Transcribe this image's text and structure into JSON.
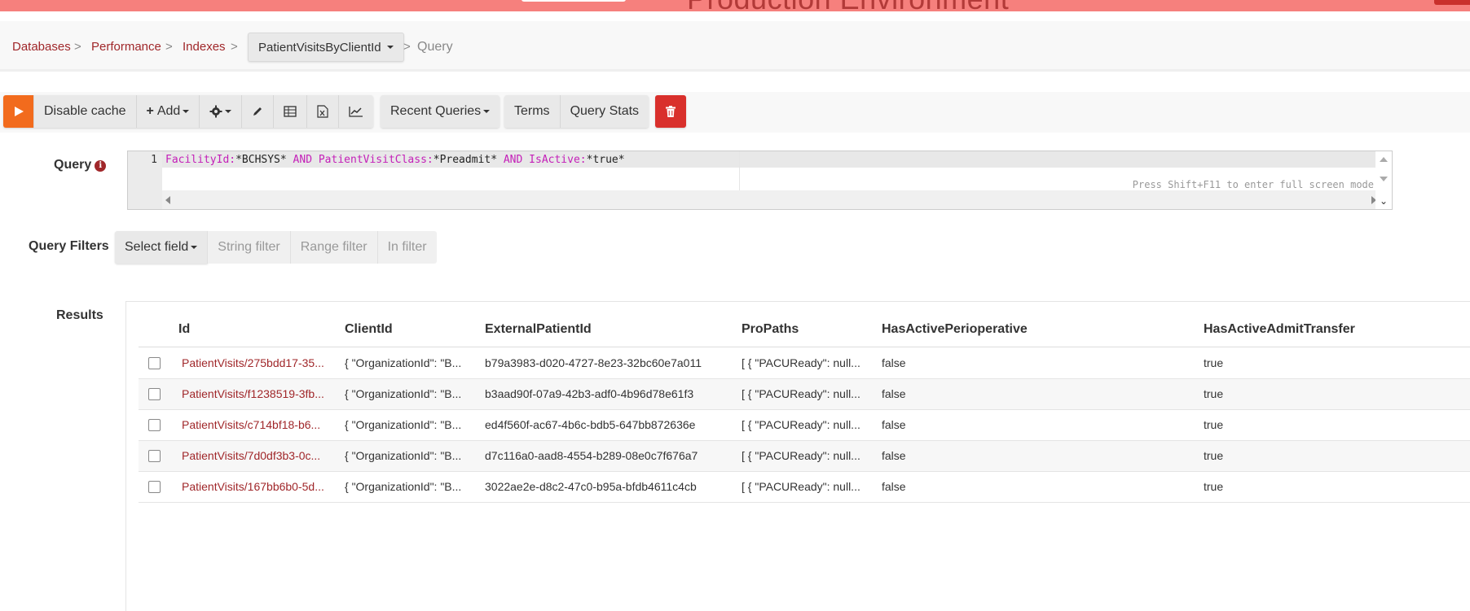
{
  "environment": {
    "banner_text": "Production Environment",
    "banner_color": "#f6807d"
  },
  "breadcrumb": {
    "items": [
      "Databases",
      "Performance",
      "Indexes"
    ],
    "separator": ">",
    "index_selector": "PatientVisitsByClientId",
    "current": "Query"
  },
  "toolbar": {
    "run_icon": "play-icon",
    "disable_cache": "Disable cache",
    "add": "Add",
    "settings_icon": "gear-icon",
    "edit_icon": "pencil-icon",
    "table_icon": "table-icon",
    "excel_icon": "excel-icon",
    "chart_icon": "line-chart-icon",
    "recent_queries": "Recent Queries",
    "terms": "Terms",
    "query_stats": "Query Stats",
    "delete_icon": "trash-icon",
    "accent_color": "#f26b1d",
    "danger_color": "#d9302c"
  },
  "query": {
    "label": "Query",
    "line_number": "1",
    "tokens": {
      "f1": "FacilityId:",
      "v1": "*BCHSYS*",
      "and1": "AND",
      "f2": "PatientVisitClass:",
      "v2": "*Preadmit*",
      "and2": "AND",
      "f3": "IsActive:",
      "v3": "*true*"
    },
    "hint": "Press Shift+F11 to enter full screen mode"
  },
  "filters": {
    "label": "Query Filters",
    "select_field": "Select field",
    "string_filter": "String filter",
    "range_filter": "Range filter",
    "in_filter": "In filter"
  },
  "results": {
    "label": "Results",
    "columns": [
      "Id",
      "ClientId",
      "ExternalPatientId",
      "ProPaths",
      "HasActivePerioperative",
      "HasActiveAdmitTransfer"
    ],
    "rows": [
      {
        "id": "PatientVisits/275bdd17-35...",
        "client": "{ \"OrganizationId\": \"B...",
        "external": "b79a3983-d020-4727-8e23-32bc60e7a011",
        "propaths": "[ { \"PACUReady\": null...",
        "periop": "false",
        "admit": "true"
      },
      {
        "id": "PatientVisits/f1238519-3fb...",
        "client": "{ \"OrganizationId\": \"B...",
        "external": "b3aad90f-07a9-42b3-adf0-4b96d78e61f3",
        "propaths": "[ { \"PACUReady\": null...",
        "periop": "false",
        "admit": "true"
      },
      {
        "id": "PatientVisits/c714bf18-b6...",
        "client": "{ \"OrganizationId\": \"B...",
        "external": "ed4f560f-ac67-4b6c-bdb5-647bb872636e",
        "propaths": "[ { \"PACUReady\": null...",
        "periop": "false",
        "admit": "true"
      },
      {
        "id": "PatientVisits/7d0df3b3-0c...",
        "client": "{ \"OrganizationId\": \"B...",
        "external": "d7c116a0-aad8-4554-b289-08e0c7f676a7",
        "propaths": "[ { \"PACUReady\": null...",
        "periop": "false",
        "admit": "true"
      },
      {
        "id": "PatientVisits/167bb6b0-5d...",
        "client": "{ \"OrganizationId\": \"B...",
        "external": "3022ae2e-d8c2-47c0-b95a-bfdb4611c4cb",
        "propaths": "[ { \"PACUReady\": null...",
        "periop": "false",
        "admit": "true"
      }
    ]
  }
}
